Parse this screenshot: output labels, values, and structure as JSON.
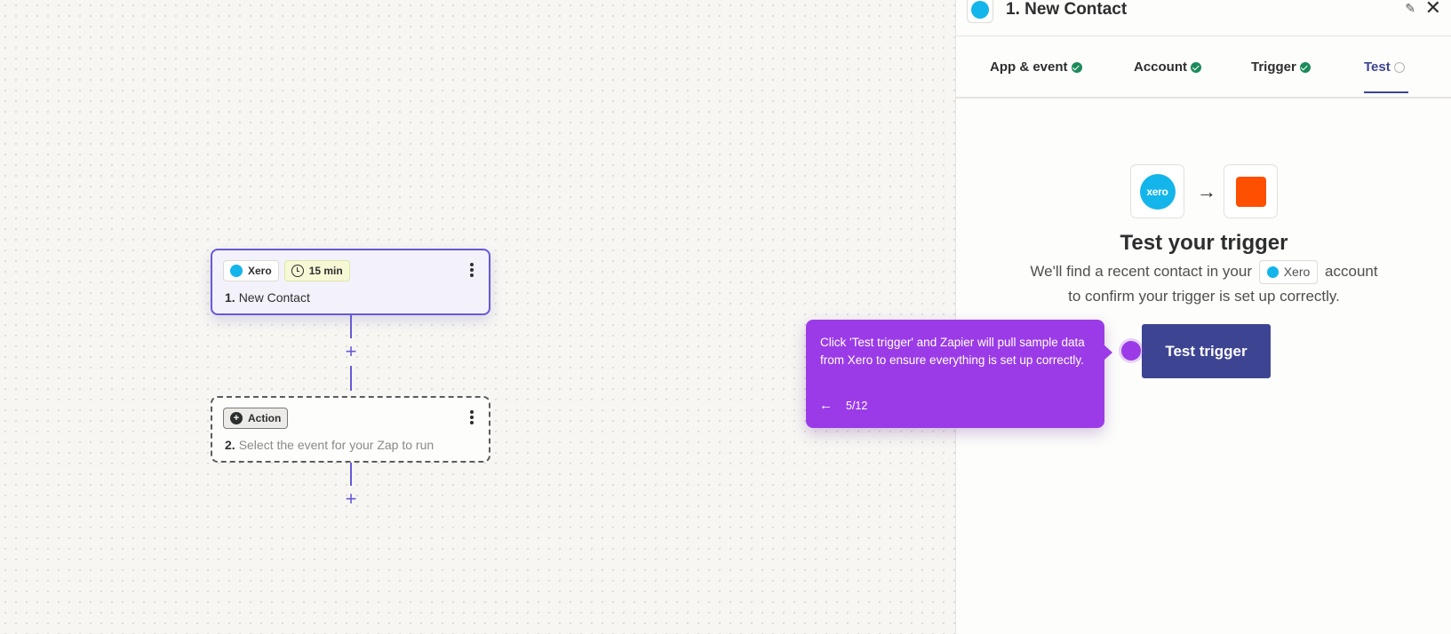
{
  "canvas": {
    "trigger_step": {
      "app_label": "Xero",
      "time_label": "15 min",
      "number": "1.",
      "title": "New Contact"
    },
    "action_step": {
      "chip_label": "Action",
      "number": "2.",
      "placeholder": "Select the event for your Zap to run"
    },
    "plus_symbol": "+"
  },
  "panel": {
    "title": "1. New Contact",
    "tabs": [
      {
        "label": "App & event",
        "status": "complete"
      },
      {
        "label": "Account",
        "status": "complete"
      },
      {
        "label": "Trigger",
        "status": "complete"
      },
      {
        "label": "Test",
        "status": "pending"
      }
    ],
    "source_app_logo_text": "xero",
    "arrow": "→",
    "heading": "Test your trigger",
    "desc_before": "We'll find a recent contact in your",
    "desc_app": "Xero",
    "desc_after_line1": "account",
    "desc_line2": "to confirm your trigger is set up correctly.",
    "test_button": "Test trigger"
  },
  "guide": {
    "text": "Click 'Test trigger' and Zapier will pull sample data from Xero to ensure everything is set up correctly.",
    "back_arrow": "←",
    "progress": "5/12"
  },
  "colors": {
    "accent": "#3d4593",
    "step_border": "#6759d7",
    "guide": "#9b3be7",
    "xero": "#13b5ea",
    "zapier": "#ff4f00",
    "complete": "#1c8a5a"
  }
}
